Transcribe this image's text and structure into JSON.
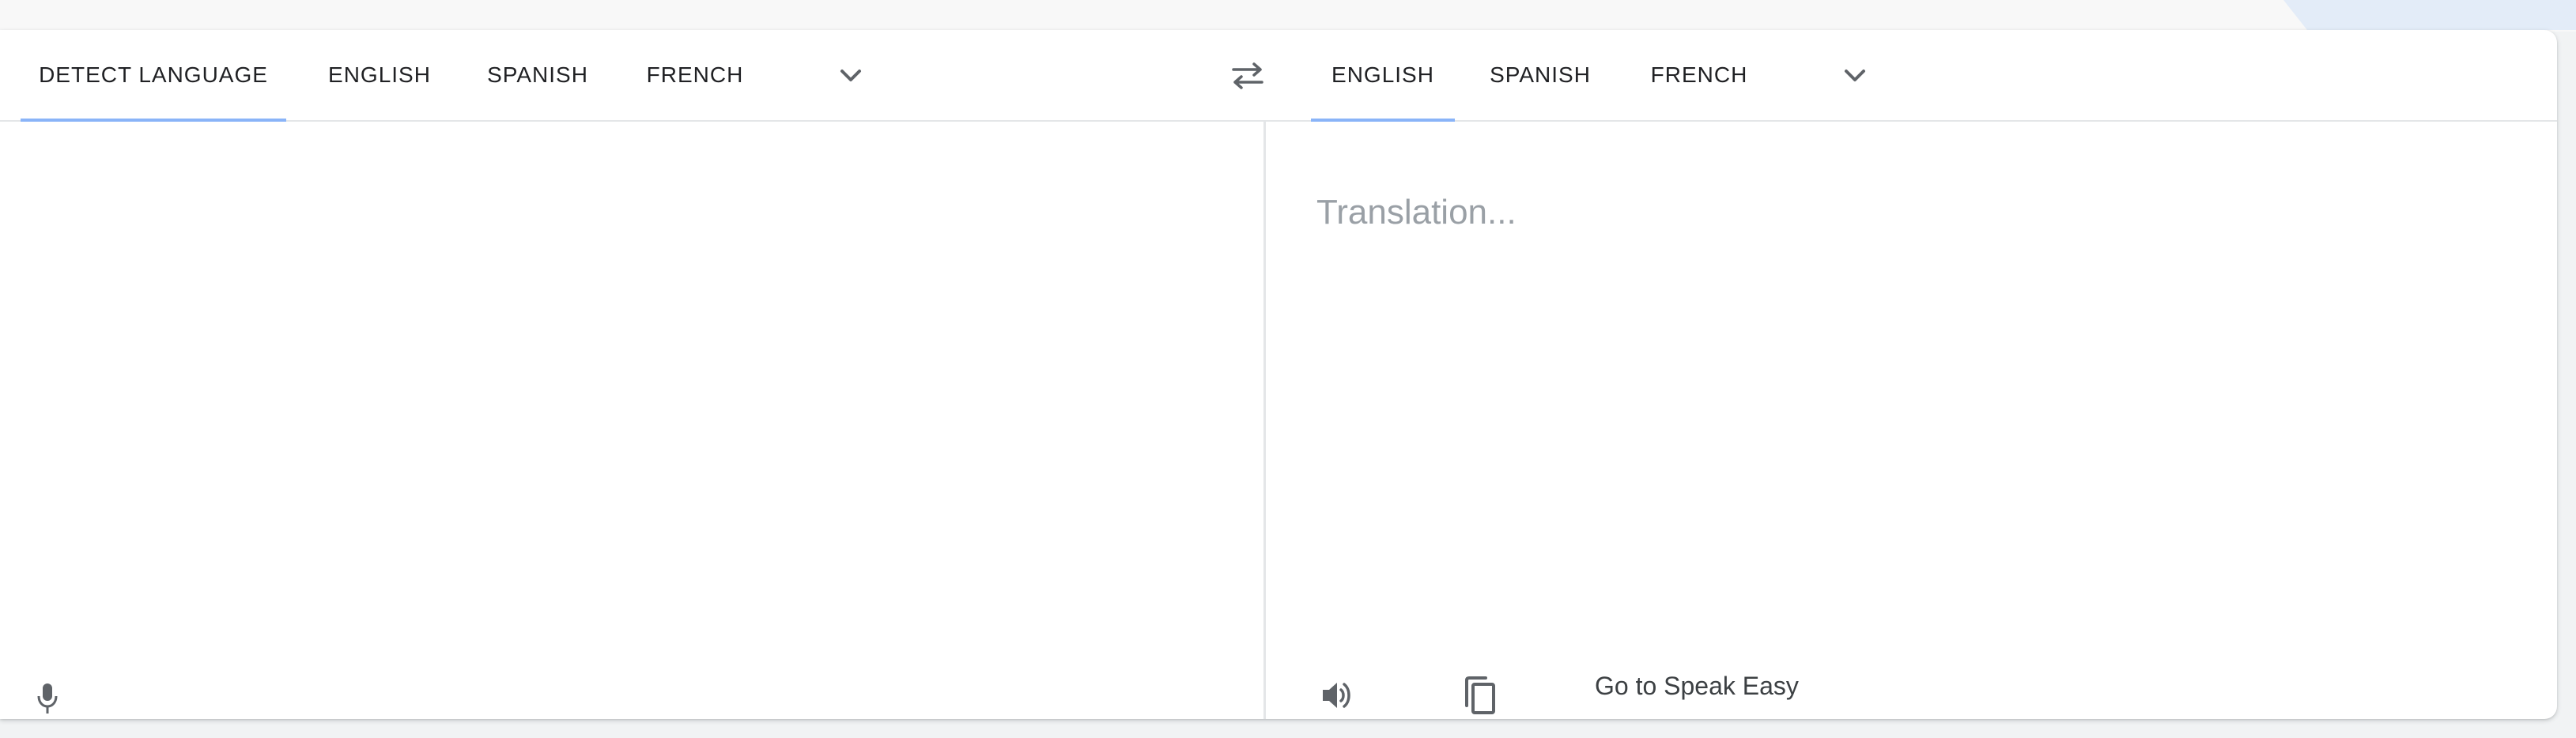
{
  "source": {
    "tabs": [
      {
        "label": "DETECT LANGUAGE",
        "active": true
      },
      {
        "label": "ENGLISH",
        "active": false
      },
      {
        "label": "SPANISH",
        "active": false
      },
      {
        "label": "FRENCH",
        "active": false
      }
    ],
    "more_icon": "chevron-down-icon",
    "text_value": "",
    "mic_icon": "microphone-icon"
  },
  "swap_icon": "swap-arrows-icon",
  "target": {
    "tabs": [
      {
        "label": "ENGLISH",
        "active": true
      },
      {
        "label": "SPANISH",
        "active": false
      },
      {
        "label": "FRENCH",
        "active": false
      }
    ],
    "more_icon": "chevron-down-icon",
    "placeholder": "Translation...",
    "speaker_icon": "speaker-icon",
    "copy_icon": "copy-icon",
    "speak_easy_link": "Go to Speak Easy"
  },
  "colors": {
    "active_tab_underline": "#8ab4f8",
    "placeholder": "#9aa0a6",
    "icon": "#5f6368"
  }
}
